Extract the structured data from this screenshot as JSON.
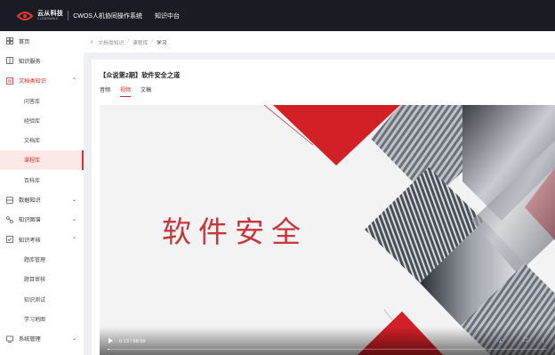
{
  "header": {
    "brand_cn": "云从科技",
    "brand_en": "CLOUDWALK",
    "system_title": "CWOS人机协同操作系统",
    "module": "知识中台"
  },
  "sidebar": {
    "items": [
      {
        "label": "首页",
        "icon": "grid-icon"
      },
      {
        "label": "知识服务",
        "icon": "book-icon"
      },
      {
        "label": "文档类知识",
        "icon": "document-icon",
        "expanded": true,
        "active": true,
        "children": [
          "问答库",
          "经验库",
          "文档库",
          "课程库",
          "百科库"
        ],
        "selected": "课程库"
      },
      {
        "label": "数据知识",
        "icon": "database-icon"
      },
      {
        "label": "知识图谱",
        "icon": "graph-icon"
      },
      {
        "label": "知识考核",
        "icon": "exam-icon",
        "expanded": true,
        "children": [
          "题库管理",
          "题目审核",
          "知识测试",
          "学习地图"
        ]
      },
      {
        "label": "系统管理",
        "icon": "settings-icon"
      }
    ]
  },
  "breadcrumb": {
    "items": [
      "文档类知识",
      "课程库",
      "学习"
    ]
  },
  "course": {
    "title": "【众说第2期】软件安全之道",
    "tabs": [
      "音频",
      "视频",
      "文稿"
    ],
    "active_tab": "视频"
  },
  "video": {
    "slide_title": "软件安全",
    "time": "0:13 / 58:59",
    "progress": 0.004
  },
  "colors": {
    "accent": "#d32f2f",
    "topbar": "#191c22"
  }
}
